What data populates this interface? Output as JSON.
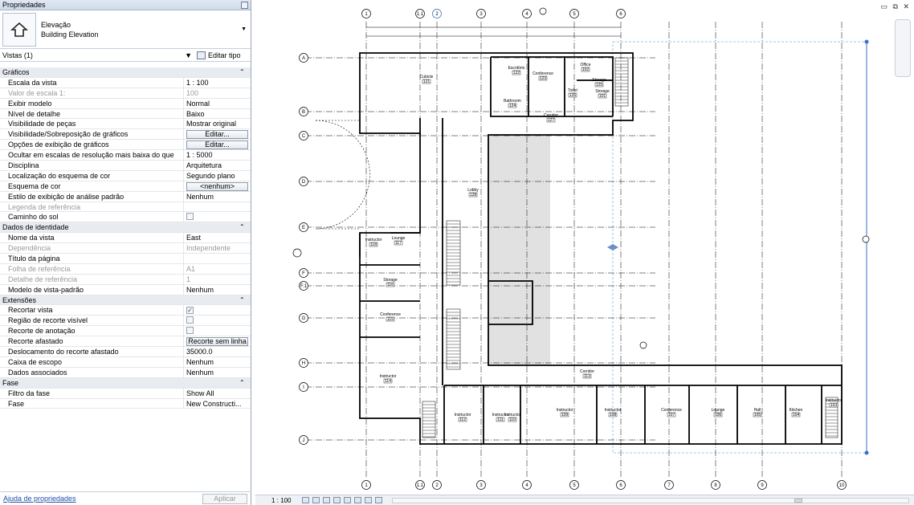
{
  "panel": {
    "title": "Propriedades",
    "type_name": "Elevação",
    "type_sub": "Building Elevation",
    "views_label": "Vistas (1)",
    "edit_type": "Editar tipo",
    "help_link": "Ajuda de propriedades",
    "apply": "Aplicar"
  },
  "rows": [
    {
      "kind": "group",
      "label": "Gráficos"
    },
    {
      "label": "Escala da vista",
      "value": "1 : 100"
    },
    {
      "label": "Valor de escala    1:",
      "value": "100",
      "disabled": true
    },
    {
      "label": "Exibir modelo",
      "value": "Normal"
    },
    {
      "label": "Nível de detalhe",
      "value": "Baixo"
    },
    {
      "label": "Visibilidade de peças",
      "value": "Mostrar original"
    },
    {
      "label": "Visibilidade/Sobreposição de gráficos",
      "button": "Editar..."
    },
    {
      "label": "Opções de exibição de gráficos",
      "button": "Editar..."
    },
    {
      "label": "Ocultar em escalas de resolução mais baixa do que",
      "value": "1 : 5000"
    },
    {
      "label": "Disciplina",
      "value": "Arquitetura"
    },
    {
      "label": "Localização do esquema de cor",
      "value": "Segundo plano"
    },
    {
      "label": "Esquema de cor",
      "button": "<nenhum>"
    },
    {
      "label": "Estilo de exibição de análise padrão",
      "value": "Nenhum"
    },
    {
      "label": "Legenda de referência",
      "value": "",
      "disabled": true
    },
    {
      "label": "Caminho do sol",
      "check": false
    },
    {
      "kind": "group",
      "label": "Dados de identidade"
    },
    {
      "label": "Nome da vista",
      "value": "East"
    },
    {
      "label": "Dependência",
      "value": "Independente",
      "disabled": true
    },
    {
      "label": "Título da página",
      "value": ""
    },
    {
      "label": "Folha de referência",
      "value": "A1",
      "disabled": true
    },
    {
      "label": "Detalhe de referência",
      "value": "1",
      "disabled": true
    },
    {
      "label": "Modelo de vista-padrão",
      "value": "Nenhum"
    },
    {
      "kind": "group",
      "label": "Extensões"
    },
    {
      "label": "Recortar vista",
      "check": true
    },
    {
      "label": "Região de recorte visível",
      "check": false
    },
    {
      "label": "Recorte de anotação",
      "check": false
    },
    {
      "label": "Recorte afastado",
      "button": "Recorte sem linha"
    },
    {
      "label": "Deslocamento do recorte afastado",
      "value": "35000.0"
    },
    {
      "label": "Caixa de escopo",
      "value": "Nenhum"
    },
    {
      "label": "Dados associados",
      "value": "Nenhum"
    },
    {
      "kind": "group",
      "label": "Fase"
    },
    {
      "label": "Filtro da fase",
      "value": "Show All"
    },
    {
      "label": "Fase",
      "value": "New Constructi..."
    }
  ],
  "statusbar": {
    "scale": "1 : 100"
  },
  "drawing": {
    "grid_top": [
      "1",
      "1.1",
      "2",
      "3",
      "4",
      "5",
      "6"
    ],
    "grid_bottom": [
      "1",
      "1.1",
      "2",
      "3",
      "4",
      "5",
      "6",
      "7",
      "8",
      "9",
      "10"
    ],
    "grid_left": [
      "A",
      "B",
      "C",
      "D",
      "E",
      "F",
      "F.1",
      "G",
      "H",
      "I",
      "J"
    ],
    "room_labels": [
      "Cubicle",
      "Escritório",
      "Conference",
      "Bathroom",
      "Storage",
      "Toilet",
      "Corridor",
      "Lobby",
      "Instructor",
      "Lounge",
      "Storage",
      "Conference",
      "Instructor",
      "Corridor",
      "Instructor",
      "Instructor",
      "Instructor",
      "Instructor",
      "Instructor",
      "Conference",
      "Lounge",
      "Hall",
      "Kitchen",
      "Instructor",
      "Office",
      "Storage"
    ],
    "room_tags": [
      "121",
      "122",
      "123",
      "124",
      "125",
      "126",
      "127",
      "128",
      "118",
      "117",
      "116",
      "115",
      "114",
      "113",
      "112",
      "111",
      "110",
      "109",
      "108",
      "107",
      "106",
      "105",
      "104",
      "103",
      "102",
      "101"
    ]
  }
}
